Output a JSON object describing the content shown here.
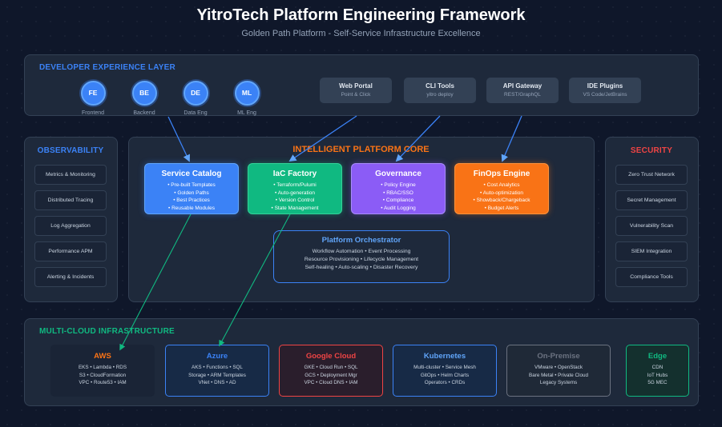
{
  "header": {
    "title": "YitroTech Platform Engineering Framework",
    "subtitle": "Golden Path Platform - Self-Service Infrastructure Excellence"
  },
  "developer_layer": {
    "title": "DEVELOPER EXPERIENCE LAYER",
    "personas": [
      {
        "abbr": "FE",
        "label": "Frontend"
      },
      {
        "abbr": "BE",
        "label": "Backend"
      },
      {
        "abbr": "DE",
        "label": "Data Eng"
      },
      {
        "abbr": "ML",
        "label": "ML Eng"
      }
    ],
    "tools": [
      {
        "name": "Web Portal",
        "sub": "Point & Click"
      },
      {
        "name": "CLI Tools",
        "sub": "yitro deploy"
      },
      {
        "name": "API Gateway",
        "sub": "REST/GraphQL"
      },
      {
        "name": "IDE Plugins",
        "sub": "VS Code/JetBrains"
      }
    ]
  },
  "observability": {
    "title": "OBSERVABILITY",
    "items": [
      "Metrics & Monitoring",
      "Distributed Tracing",
      "Log Aggregation",
      "Performance APM",
      "Alerting & Incidents"
    ]
  },
  "security": {
    "title": "SECURITY",
    "items": [
      "Zero Trust Network",
      "Secret Management",
      "Vulnerability Scan",
      "SIEM Integration",
      "Compliance Tools"
    ]
  },
  "core": {
    "title": "INTELLIGENT PLATFORM CORE",
    "cards": [
      {
        "name": "Service Catalog",
        "lines": [
          "• Pre-built Templates",
          "• Golden Paths",
          "• Best Practices",
          "• Reusable Modules"
        ],
        "color": "#3b82f6"
      },
      {
        "name": "IaC Factory",
        "lines": [
          "• Terraform/Pulumi",
          "• Auto-generation",
          "• Version Control",
          "• State Management"
        ],
        "color": "#10b981"
      },
      {
        "name": "Governance",
        "lines": [
          "• Policy Engine",
          "• RBAC/SSO",
          "• Compliance",
          "• Audit Logging"
        ],
        "color": "#8b5cf6"
      },
      {
        "name": "FinOps Engine",
        "lines": [
          "• Cost Analytics",
          "• Auto-optimization",
          "• Showback/Chargeback",
          "• Budget Alerts"
        ],
        "color": "#f97316"
      }
    ],
    "orchestrator": {
      "name": "Platform Orchestrator",
      "lines": [
        "Workflow Automation • Event Processing",
        "Resource Provisioning • Lifecycle Management",
        "Self-healing • Auto-scaling • Disaster Recovery"
      ]
    }
  },
  "multicloud": {
    "title": "MULTI-CLOUD INFRASTRUCTURE",
    "clouds": [
      {
        "name": "AWS",
        "lines": [
          "EKS • Lambda • RDS",
          "S3 • CloudFormation",
          "VPC • Route53 • IAM"
        ],
        "color": "#f97316"
      },
      {
        "name": "Azure",
        "lines": [
          "AKS • Functions • SQL",
          "Storage • ARM Templates",
          "VNet • DNS • AD"
        ],
        "color": "#3b82f6"
      },
      {
        "name": "Google Cloud",
        "lines": [
          "GKE • Cloud Run • SQL",
          "GCS • Deployment Mgr",
          "VPC • Cloud DNS • IAM"
        ],
        "color": "#ef4444"
      },
      {
        "name": "Kubernetes",
        "lines": [
          "Multi-cluster • Service Mesh",
          "GitOps • Helm Charts",
          "Operators • CRDs"
        ],
        "color": "#3b82f6"
      },
      {
        "name": "On-Premise",
        "lines": [
          "VMware • OpenStack",
          "Bare Metal • Private Cloud",
          "Legacy Systems"
        ],
        "color": "#6b7280"
      },
      {
        "name": "Edge",
        "lines": [
          "CDN",
          "IoT Hubs",
          "5G MEC"
        ],
        "color": "#10b981"
      }
    ]
  },
  "colors": {
    "background": "#0f172a",
    "panel": "#1e293b",
    "developer_accent": "#3b82f6",
    "observability_accent": "#3b82f6",
    "security_accent": "#ef4444",
    "core_accent": "#f97316",
    "multicloud_accent": "#10b981"
  }
}
